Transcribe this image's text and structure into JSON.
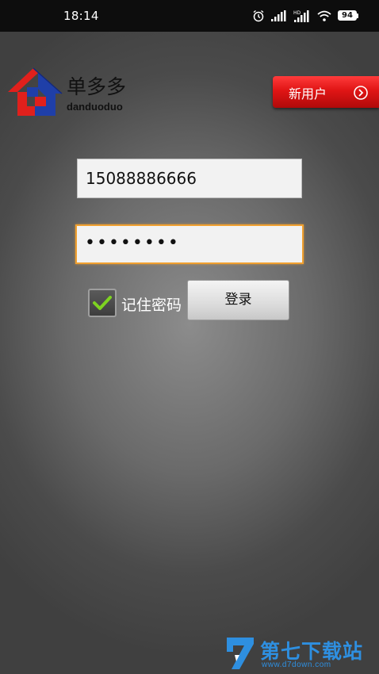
{
  "status_bar": {
    "time": "18:14",
    "battery": "94",
    "icons": [
      "alarm-icon",
      "signal-icon",
      "hd-signal-icon",
      "wifi-icon",
      "battery-icon"
    ]
  },
  "brand": {
    "name": "单多多",
    "subtitle": "danduoduo"
  },
  "header": {
    "new_user_label": "新用户"
  },
  "form": {
    "phone_value": "15088886666",
    "password_value": "••••••••",
    "remember_label": "记住密码",
    "remember_checked": true,
    "login_label": "登录"
  },
  "watermark": {
    "title": "第七下载站",
    "url": "www.d7down.com"
  },
  "colors": {
    "new_user_button": "#e01515",
    "focus_border": "#f0a030",
    "logo_red": "#e0201c",
    "logo_blue": "#1f3fa8",
    "watermark": "#2e8fe0"
  }
}
